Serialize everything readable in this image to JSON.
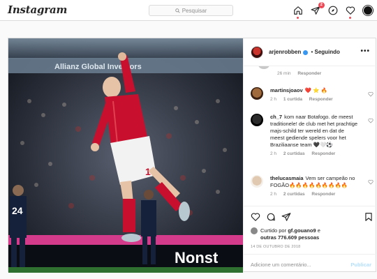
{
  "header": {
    "logo": "Instagram",
    "search_placeholder": "Pesquisar",
    "notification_count": "2",
    "icons": [
      "home-icon",
      "direct-icon",
      "explore-icon",
      "activity-heart-icon",
      "profile-avatar"
    ]
  },
  "post": {
    "author": "arjenrobben",
    "follow_status": "Seguindo",
    "more_label": "•••",
    "photo_texts": {
      "banner": "Allianz  Global Investors",
      "jersey_number": "10",
      "player_number_left": "24",
      "board_text": "Nonst"
    },
    "top_comment_meta": {
      "time": "26 min",
      "reply": "Responder"
    },
    "comments": [
      {
        "username": "martinsjoaov",
        "text": "❤️ ⭐ 🔥",
        "time": "2 h",
        "likes": "1 curtida",
        "reply": "Responder"
      },
      {
        "username": "ch_7",
        "text": "kom naar Botafogo. de meest traditionele! de club met het prachtige majs-schild ter wereld en dat de meest gediende spelers voor het Braziliaanse team 🖤🤍⚽",
        "time": "2 h",
        "likes": "2 curtidas",
        "reply": "Responder"
      },
      {
        "username": "thelucasmaia",
        "text": "Vem ser campeão no FOGÃO🔥🔥🔥🔥🔥🔥🔥🔥🔥",
        "time": "2 h",
        "likes": "2 curtidas",
        "reply": "Responder"
      }
    ],
    "liked_by_prefix": "Curtido por",
    "liked_by_user": "gf.gouano9",
    "liked_by_joiner": "e",
    "liked_by_others": "outras 776.609 pessoas",
    "date": "14 DE OUTUBRO DE 2018",
    "comment_placeholder": "Adicione um comentário...",
    "publish_label": "Publicar"
  },
  "colors": {
    "accent": "#3897f0",
    "badge": "#ed4956",
    "publish_disabled": "#b2dffc",
    "jersey_red": "#c8102e"
  }
}
